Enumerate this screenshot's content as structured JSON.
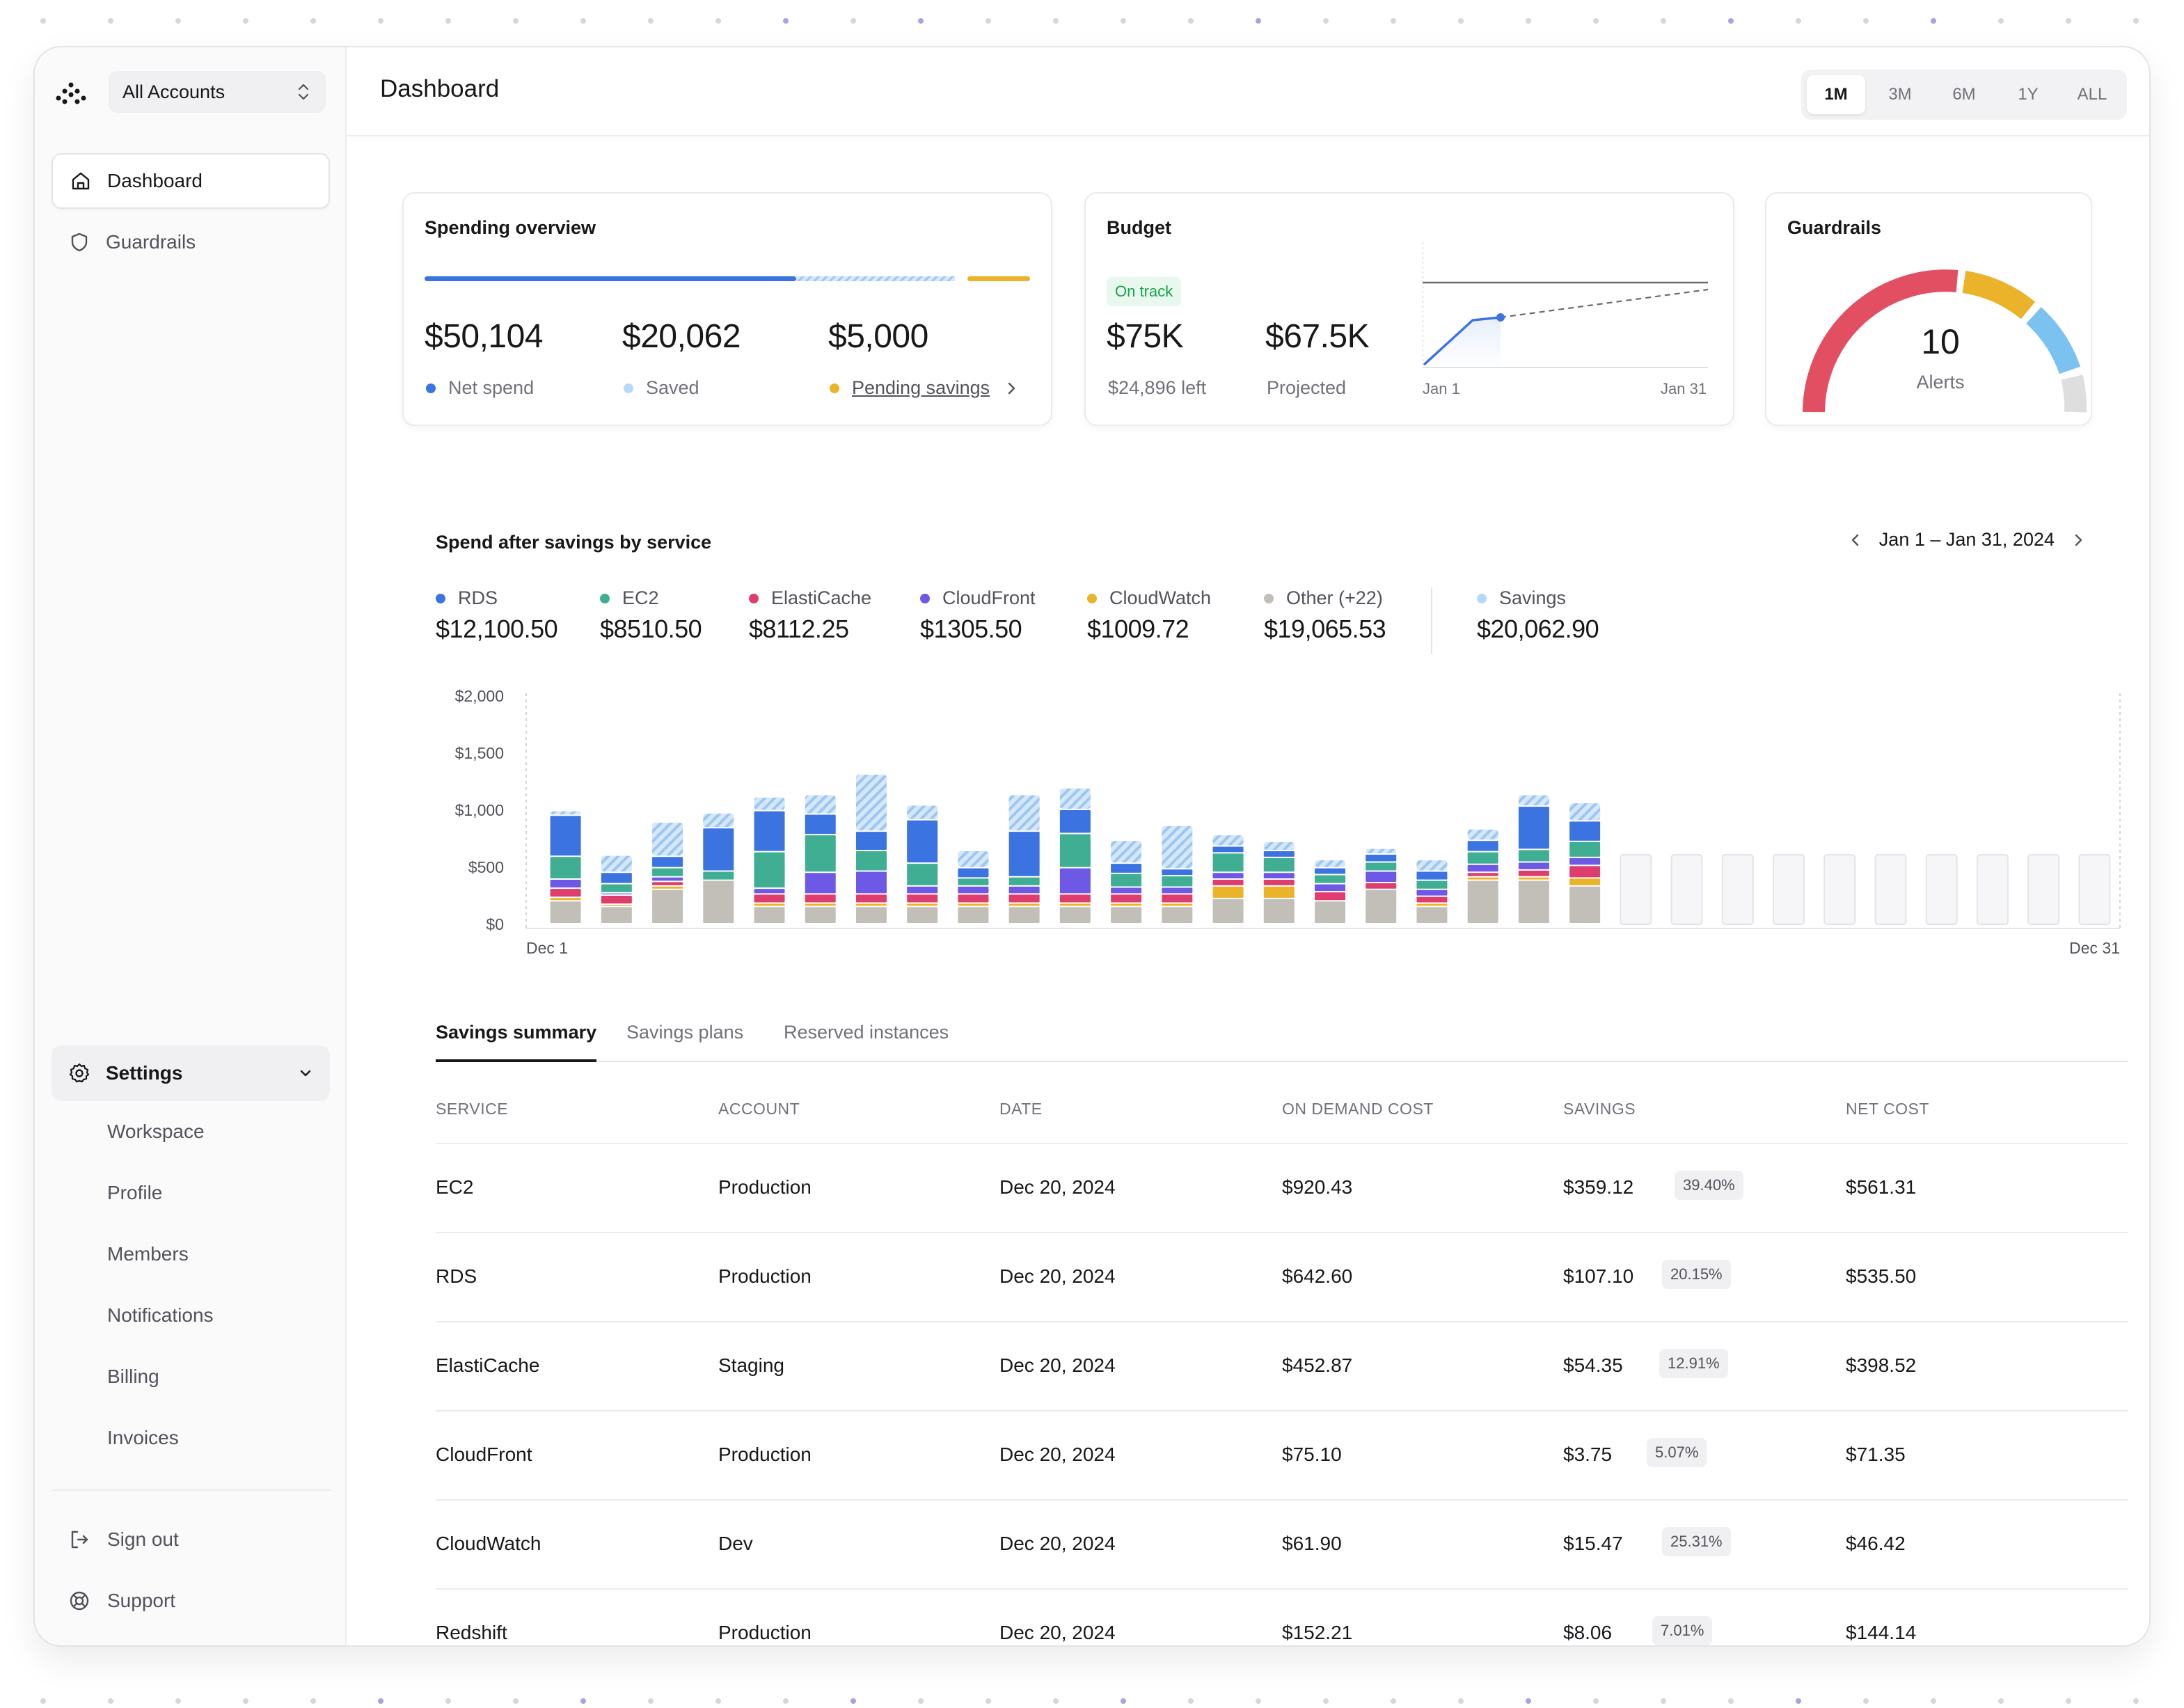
{
  "sidebar": {
    "account_selector": "All Accounts",
    "nav": [
      {
        "label": "Dashboard"
      },
      {
        "label": "Guardrails"
      }
    ],
    "settings": {
      "label": "Settings",
      "items": [
        "Workspace",
        "Profile",
        "Members",
        "Notifications",
        "Billing",
        "Invoices"
      ]
    },
    "footer": [
      {
        "label": "Sign out"
      },
      {
        "label": "Support"
      }
    ]
  },
  "header": {
    "title": "Dashboard",
    "ranges": [
      "1M",
      "3M",
      "6M",
      "1Y",
      "ALL"
    ],
    "selected_range": "1M"
  },
  "spending": {
    "title": "Spending overview",
    "net_spend_value": "$50,104",
    "net_spend_label": "Net spend",
    "saved_value": "$20,062",
    "saved_label": "Saved",
    "pending_value": "$5,000",
    "pending_label": "Pending savings"
  },
  "budget": {
    "title": "Budget",
    "status": "On track",
    "budget_value": "$75K",
    "budget_sub": "$24,896 left",
    "projected_value": "$67.5K",
    "projected_label": "Projected",
    "x_start": "Jan 1",
    "x_end": "Jan 31"
  },
  "guardrails": {
    "title": "Guardrails",
    "count": "10",
    "label": "Alerts"
  },
  "spend_section": {
    "title": "Spend after savings by service",
    "date_range": "Jan 1 – Jan 31, 2024",
    "legend": [
      {
        "name": "RDS",
        "value": "$12,100.50",
        "color": "#3b73e0"
      },
      {
        "name": "EC2",
        "value": "$8510.50",
        "color": "#3fae92"
      },
      {
        "name": "ElastiCache",
        "value": "$8112.25",
        "color": "#de3e6e"
      },
      {
        "name": "CloudFront",
        "value": "$1305.50",
        "color": "#6e59e6"
      },
      {
        "name": "CloudWatch",
        "value": "$1009.72",
        "color": "#eab32a"
      },
      {
        "name": "Other (+22)",
        "value": "$19,065.53",
        "color": "#c2bfb8"
      },
      {
        "name": "Savings",
        "value": "$20,062.90",
        "color": "#b8d8f8"
      }
    ]
  },
  "chart_data": {
    "type": "bar",
    "stacked": true,
    "ylim": [
      0,
      2000
    ],
    "yticks": [
      "$2,000",
      "$1,500",
      "$1,000",
      "$500",
      "$0"
    ],
    "x_start_label": "Dec 1",
    "x_end_label": "Dec 31",
    "days": 31,
    "series_order": [
      "Other",
      "CloudWatch",
      "ElastiCache",
      "CloudFront",
      "EC2",
      "RDS",
      "Savings"
    ],
    "series": [
      {
        "name": "Other",
        "values": [
          200,
          150,
          300,
          380,
          150,
          150,
          150,
          150,
          150,
          150,
          150,
          150,
          150,
          220,
          220,
          200,
          300,
          150,
          380,
          380,
          330
        ]
      },
      {
        "name": "CloudWatch",
        "values": [
          30,
          20,
          30,
          0,
          30,
          30,
          30,
          30,
          30,
          30,
          30,
          30,
          30,
          110,
          110,
          0,
          0,
          30,
          30,
          30,
          70
        ]
      },
      {
        "name": "ElastiCache",
        "values": [
          80,
          80,
          40,
          0,
          80,
          80,
          80,
          80,
          80,
          80,
          80,
          80,
          80,
          60,
          60,
          80,
          60,
          60,
          40,
          60,
          110
        ]
      },
      {
        "name": "CloudFront",
        "values": [
          80,
          20,
          40,
          0,
          50,
          190,
          200,
          70,
          70,
          70,
          230,
          60,
          60,
          60,
          60,
          70,
          100,
          60,
          70,
          70,
          70
        ]
      },
      {
        "name": "EC2",
        "values": [
          200,
          80,
          80,
          80,
          320,
          330,
          180,
          200,
          70,
          80,
          300,
          120,
          100,
          170,
          130,
          80,
          80,
          80,
          110,
          110,
          140
        ]
      },
      {
        "name": "RDS",
        "values": [
          360,
          100,
          100,
          380,
          360,
          180,
          170,
          380,
          90,
          400,
          210,
          90,
          60,
          60,
          60,
          60,
          70,
          80,
          100,
          380,
          180
        ]
      },
      {
        "name": "Savings",
        "values": [
          40,
          150,
          300,
          130,
          120,
          170,
          500,
          130,
          150,
          320,
          190,
          200,
          380,
          100,
          80,
          70,
          50,
          100,
          100,
          100,
          160
        ]
      }
    ],
    "future_placeholder_days": 10
  },
  "tabs": [
    "Savings summary",
    "Savings plans",
    "Reserved instances"
  ],
  "table": {
    "columns": [
      "SERVICE",
      "ACCOUNT",
      "DATE",
      "ON DEMAND COST",
      "SAVINGS",
      "NET COST"
    ],
    "rows": [
      {
        "service": "EC2",
        "account": "Production",
        "date": "Dec 20, 2024",
        "on_demand": "$920.43",
        "savings": "$359.12",
        "pct": "39.40%",
        "net": "$561.31"
      },
      {
        "service": "RDS",
        "account": "Production",
        "date": "Dec 20, 2024",
        "on_demand": "$642.60",
        "savings": "$107.10",
        "pct": "20.15%",
        "net": "$535.50"
      },
      {
        "service": "ElastiCache",
        "account": "Staging",
        "date": "Dec 20, 2024",
        "on_demand": "$452.87",
        "savings": "$54.35",
        "pct": "12.91%",
        "net": "$398.52"
      },
      {
        "service": "CloudFront",
        "account": "Production",
        "date": "Dec 20, 2024",
        "on_demand": "$75.10",
        "savings": "$3.75",
        "pct": "5.07%",
        "net": "$71.35"
      },
      {
        "service": "CloudWatch",
        "account": "Dev",
        "date": "Dec 20, 2024",
        "on_demand": "$61.90",
        "savings": "$15.47",
        "pct": "25.31%",
        "net": "$46.42"
      },
      {
        "service": "Redshift",
        "account": "Production",
        "date": "Dec 20, 2024",
        "on_demand": "$152.21",
        "savings": "$8.06",
        "pct": "7.01%",
        "net": "$144.14"
      }
    ]
  },
  "colors": {
    "blue": "#3b73e0",
    "saved": "#b8d8f8",
    "pending": "#eab32a",
    "gauge_red": "#e24f62",
    "gauge_yellow": "#eab32a",
    "gauge_blue": "#7cc2f0",
    "gauge_grey": "#dedede"
  }
}
